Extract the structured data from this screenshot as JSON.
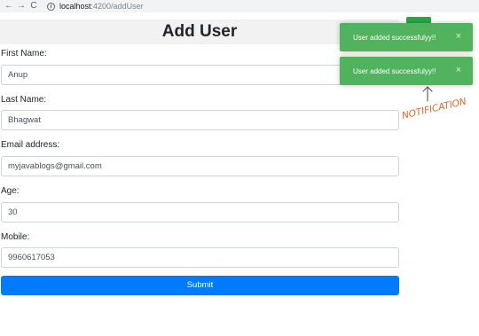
{
  "browser": {
    "back_glyph": "←",
    "forward_glyph": "→",
    "reload_glyph": "C",
    "info_glyph": "i",
    "url_host": "localhost",
    "url_path": ":4200/addUser"
  },
  "page": {
    "title": "Add User"
  },
  "form": {
    "fields": [
      {
        "label": "First Name:",
        "value": "Anup"
      },
      {
        "label": "Last Name:",
        "value": "Bhagwat"
      },
      {
        "label": "Email address:",
        "value": "myjavablogs@gmail.com"
      },
      {
        "label": "Age:",
        "value": "30"
      },
      {
        "label": "Mobile:",
        "value": "9960617053"
      }
    ],
    "submit_label": "Submit"
  },
  "toasts": [
    {
      "message": "User added successfulyy!!",
      "close_glyph": "×"
    },
    {
      "message": "User added successfulyy!!",
      "close_glyph": "×"
    }
  ],
  "annotation": {
    "text": "NOTIFICATION",
    "color": "#e8632a"
  },
  "colors": {
    "primary": "#007bff",
    "toast_success": "#51b35e",
    "annotation": "#e8632a"
  }
}
